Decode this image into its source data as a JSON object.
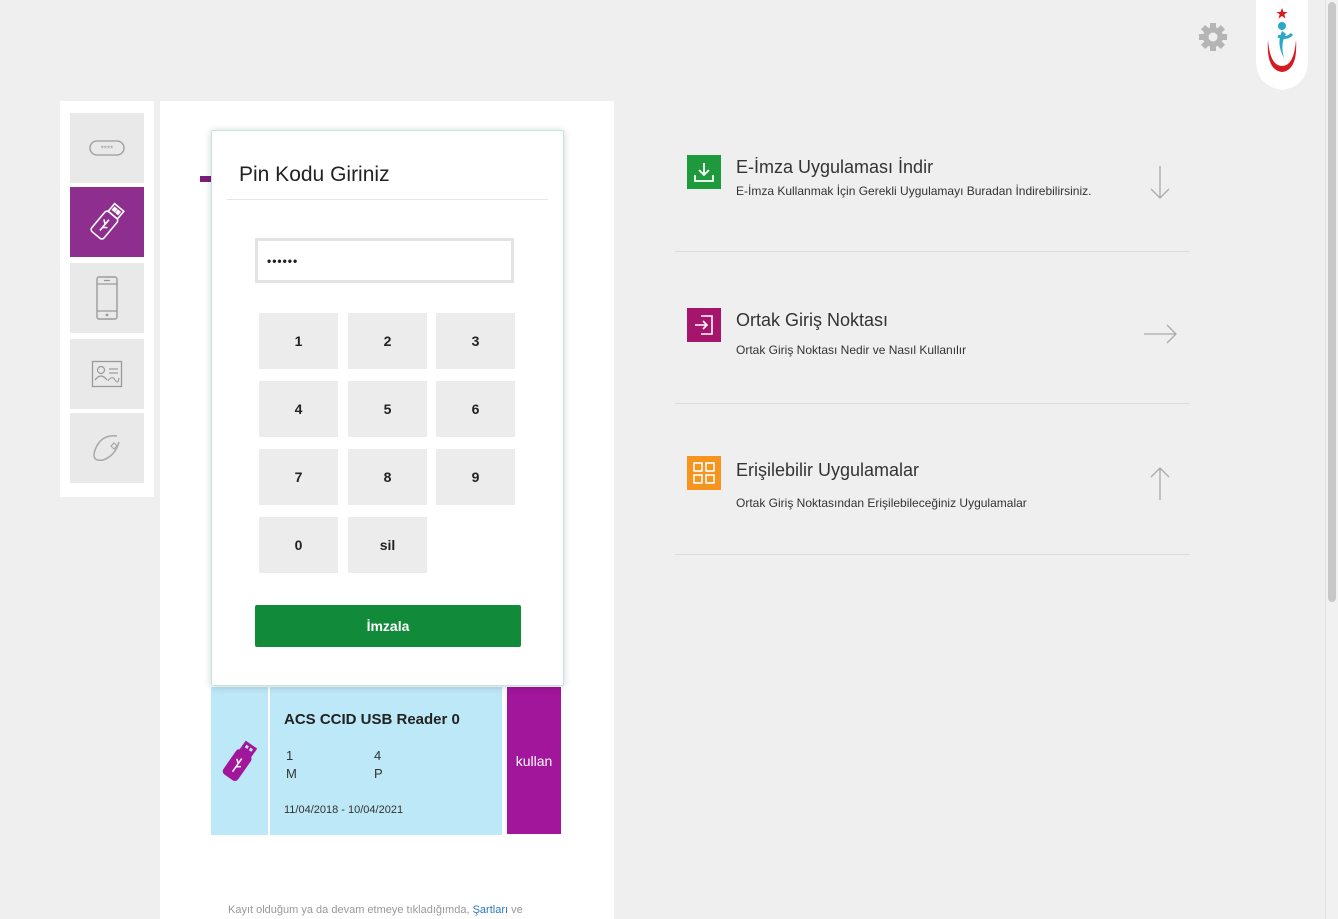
{
  "header": {
    "settings_icon": "gear-icon",
    "logo": "ministry-health-logo"
  },
  "rail": {
    "tabs": [
      {
        "icon": "pin-password-icon",
        "active": false
      },
      {
        "icon": "usb-token-icon",
        "active": true
      },
      {
        "icon": "mobile-phone-icon",
        "active": false
      },
      {
        "icon": "id-card-icon",
        "active": false
      },
      {
        "icon": "e-signature-icon",
        "active": false
      }
    ]
  },
  "pin_modal": {
    "title": "Pin Kodu Giriniz",
    "pin_value": "••••••",
    "keys": [
      "1",
      "2",
      "3",
      "4",
      "5",
      "6",
      "7",
      "8",
      "9",
      "0",
      "sil"
    ],
    "sign_label": "İmzala"
  },
  "reader": {
    "name": "ACS CCID USB Reader 0",
    "line1_a": "1",
    "line1_b": "4",
    "line2_a": "M",
    "line2_b": "P",
    "validity": "11/04/2018 - 10/04/2021",
    "use_label": "kullan"
  },
  "footer": {
    "text_before": "Kayıt olduğum ya da devam etmeye tıkladığımda, ",
    "link": "Şartları",
    "text_after": " ve"
  },
  "info_items": [
    {
      "title": "E-İmza Uygulaması İndir",
      "desc": "E-İmza Kullanmak İçin Gerekli Uygulamayı Buradan İndirebilirsiniz.",
      "icon": "download-icon",
      "arrow": "arrow-down-icon",
      "color": "#1e9a3c"
    },
    {
      "title": "Ortak Giriş Noktası",
      "desc": "Ortak Giriş Noktası Nedir ve Nasıl Kullanılır",
      "icon": "login-icon",
      "arrow": "arrow-right-icon",
      "color": "#a5156b"
    },
    {
      "title": "Erişilebilir Uygulamalar",
      "desc": "Ortak Giriş Noktasından Erişilebileceğiniz Uygulamalar",
      "icon": "grid-apps-icon",
      "arrow": "arrow-up-icon",
      "color": "#f7941d"
    }
  ]
}
